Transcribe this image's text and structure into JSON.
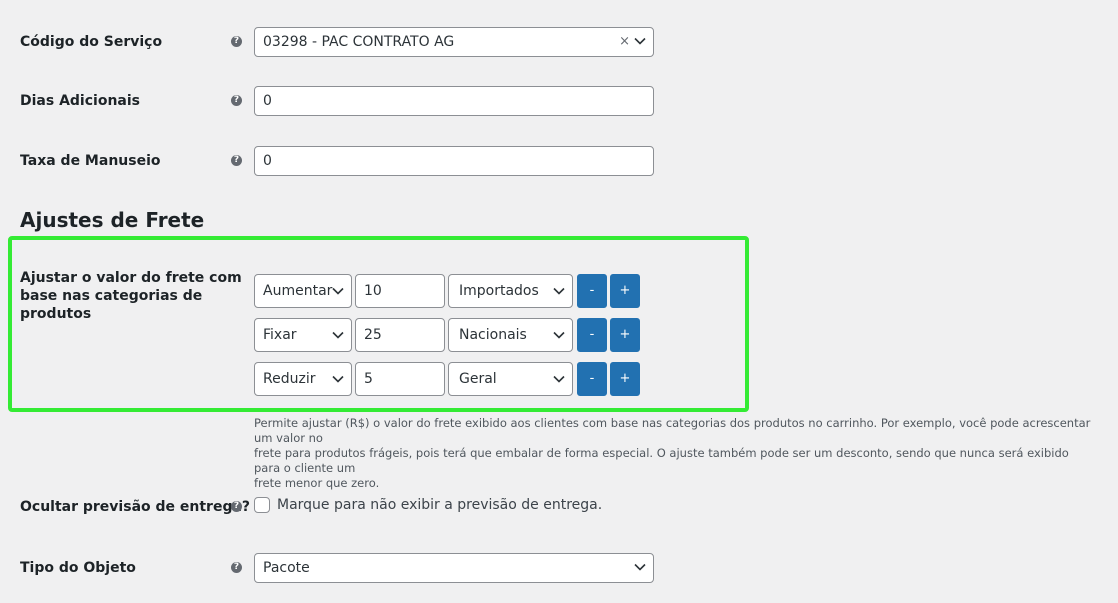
{
  "fields": {
    "codigo": {
      "label": "Código do Serviço",
      "value": "03298 - PAC CONTRATO AG",
      "clear": "×"
    },
    "dias": {
      "label": "Dias Adicionais",
      "value": "0"
    },
    "taxa": {
      "label": "Taxa de Manuseio",
      "value": "0"
    }
  },
  "help_glyph": "?",
  "section_title": "Ajustes de Frete",
  "ajuste": {
    "label_lines": [
      "Ajustar o valor do frete com",
      "base nas categorias de",
      "produtos"
    ],
    "rows": [
      {
        "action": "Aumentar",
        "value": "10",
        "category": "Importados"
      },
      {
        "action": "Fixar",
        "value": "25",
        "category": "Nacionais"
      },
      {
        "action": "Reduzir",
        "value": "5",
        "category": "Geral"
      }
    ],
    "minus": "-",
    "plus": "+",
    "highlight_color": "#34eb34",
    "description_lines": [
      "Permite ajustar (R$) o valor do frete exibido aos clientes com base nas categorias dos produtos no carrinho. Por exemplo, você pode acrescentar um valor no",
      "frete para produtos frágeis, pois terá que embalar de forma especial. O ajuste também pode ser um desconto, sendo que nunca será exibido para o cliente um",
      "frete menor que zero."
    ]
  },
  "ocultar": {
    "label": "Ocultar previsão de entrega?",
    "checkbox_label": "Marque para não exibir a previsão de entrega.",
    "checked": false
  },
  "tipo": {
    "label": "Tipo do Objeto",
    "value": "Pacote"
  },
  "colors": {
    "button": "#2271b1",
    "background": "#f0f0f1"
  }
}
